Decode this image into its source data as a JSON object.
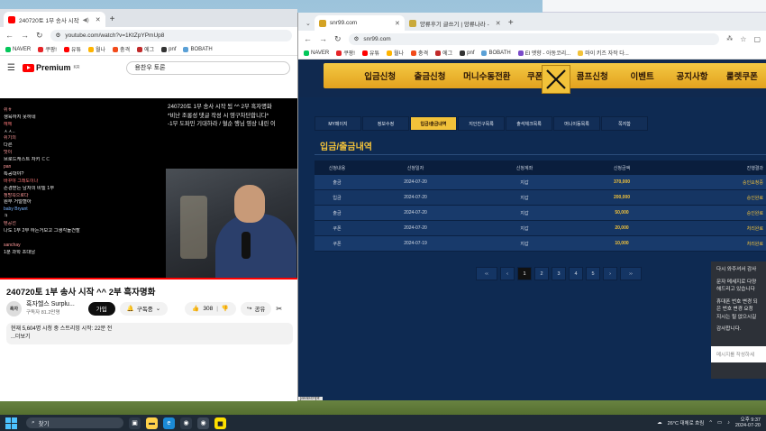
{
  "left_window": {
    "tab_title": "240720토 1부 송사 시작",
    "url": "youtube.com/watch?v=1KtZpYPmUp8",
    "bookmarks": [
      "NAVER",
      "쿠팡!",
      "유튜",
      "월나",
      "충격",
      "에그",
      "pnf",
      "BOBATH",
      "El 엣향 - 아동코리...",
      "마이 키즈 자작 다..."
    ],
    "yt_logo": "Premium",
    "yt_logo_sup": "KR",
    "search_value": "용찬우 토론",
    "chat_lines": [
      {
        "user": "",
        "text": "",
        "color": "#e8e8e8"
      },
      {
        "user": "쉬ㅎ",
        "text": "",
        "color": "#ff9a9a"
      },
      {
        "user": "",
        "text": "생육하지 못하네",
        "color": "#e8e8e8"
      },
      {
        "user": "헤헤",
        "text": "",
        "color": "#ff7a7a"
      },
      {
        "user": "",
        "text": "ㅅㅅ..",
        "color": "#e8e8e8"
      },
      {
        "user": "쉬기의",
        "text": "",
        "color": "#ff9a9a"
      },
      {
        "user": "",
        "text": "다른",
        "color": "#e8e8e8"
      },
      {
        "user": "맛이",
        "text": "",
        "color": "#ff9a9a"
      },
      {
        "user": "",
        "text": "브로드캐스트 자키 ㄷㄷ",
        "color": "#e8e8e8"
      },
      {
        "user": "pan",
        "text": "",
        "color": "#ff9a9a"
      },
      {
        "user": "",
        "text": "특공대야?",
        "color": "#e8e8e8"
      },
      {
        "user": "바꾸야 그래도이나",
        "text": "",
        "color": "#ff7a7a"
      },
      {
        "user": "",
        "text": "존경받는 남자의 비밀 1부",
        "color": "#e8e8e8"
      },
      {
        "user": "정망쪽으로다",
        "text": "",
        "color": "#ff9a9a"
      },
      {
        "user": "",
        "text": "원부 거덜혈아",
        "color": "#e8e8e8"
      },
      {
        "user": "baby Bryant",
        "text": "",
        "color": "#7ab4ff"
      },
      {
        "user": "",
        "text": "ㅋ",
        "color": "#e8e8e8"
      },
      {
        "user": "텐공선",
        "text": "",
        "color": "#ff9a9a"
      },
      {
        "user": "",
        "text": "나도 1부 2부 하는거보고 그생각들건할",
        "color": "#e8e8e8"
      },
      {
        "user": "",
        "text": "",
        "color": "#e8e8e8"
      },
      {
        "user": "sanchay",
        "text": "",
        "color": "#ff9a9a"
      },
      {
        "user": "",
        "text": "1분 과학 초대남",
        "color": "#e8e8e8"
      }
    ],
    "overlay_lines": [
      "240720토 1부 송사 시작 됨 ^^ 2부 흑자명화",
      "*비난 조롱성 댓글 작성 시 영구차단합니다*",
      "-1부 도파민 기대하라 / 혈순 행님 영상 내린 이"
    ],
    "video_title": "240720토 1부 송사 시작 ^^ 2부 흑자명화",
    "channel_name": "흑자헬스 Surplu...",
    "channel_subs": "구독자 81.2만명",
    "channel_avatar": "흑자",
    "join_label": "가입",
    "subscribed_label": "구독중",
    "like_count": "308",
    "share_label": "공유",
    "desc_line1": "현재 5,604명 시청 중 스트리밍 시작: 22분 전",
    "desc_line2": "...더보기"
  },
  "right_window": {
    "tabs": [
      "snr99.com",
      "양류후기 글쓰기 | 앙류나라 -"
    ],
    "url": "snr99.com",
    "bookmarks": [
      "NAVER",
      "쿠팡!",
      "유튜",
      "월나",
      "충격",
      "에그",
      "pnf",
      "BOBATH",
      "El 엣향 - 아동코리...",
      "마이 키즈 자작 다..."
    ],
    "nav_items": [
      "입금신청",
      "출금신청",
      "머니수동전환",
      "쿠폰",
      "콤프신청",
      "이벤트",
      "공지사항",
      "룰렛쿠폰"
    ],
    "sub_tabs": [
      "MY페이지",
      "정보수정",
      "입금/출금내역",
      "지인친구목록",
      "출석체크목록",
      "머니이동목록",
      "쪽지함"
    ],
    "active_sub_tab": 2,
    "page_heading": "입금/출금내역",
    "table_headers": [
      "신청내용",
      "신청일자",
      "신청계좌",
      "신청금액",
      "진행결과"
    ],
    "rows": [
      {
        "type": "출금",
        "date": "2024-07-20",
        "account": "지갑",
        "amount": "370,000",
        "status": "승인요청중"
      },
      {
        "type": "입금",
        "date": "2024-07-20",
        "account": "지갑",
        "amount": "200,000",
        "status": "승인완료"
      },
      {
        "type": "출금",
        "date": "2024-07-20",
        "account": "지갑",
        "amount": "50,000",
        "status": "승인완료"
      },
      {
        "type": "쿠폰",
        "date": "2024-07-20",
        "account": "지갑",
        "amount": "20,000",
        "status": "처리완료"
      },
      {
        "type": "쿠폰",
        "date": "2024-07-19",
        "account": "지갑",
        "amount": "10,000",
        "status": "처리완료"
      }
    ],
    "pager": [
      "‹‹",
      "‹",
      "1",
      "2",
      "3",
      "4",
      "5",
      "›",
      "››"
    ],
    "active_page": "1",
    "chat_popup_lines": [
      "다시 와주셔서 감사",
      "",
      "문자 메세지로 다양",
      "해드리고 있습니다",
      "",
      "휴대폰 번호 변경 되",
      "은 번호 변경 요청",
      "지시는 될 없으시길",
      "",
      "감사합니다."
    ],
    "chat_input_placeholder": "메시지를 작성하세",
    "status_text": "javascript:"
  },
  "taskbar": {
    "search_label": "찾기",
    "weather": "26°C 대체로 흐림",
    "time": "오후 9:37",
    "date": "2024-07-20"
  },
  "colors": {
    "gold": "#f2c23a",
    "site_bg": "#0e2a52",
    "youtube_red": "#ff0000"
  }
}
